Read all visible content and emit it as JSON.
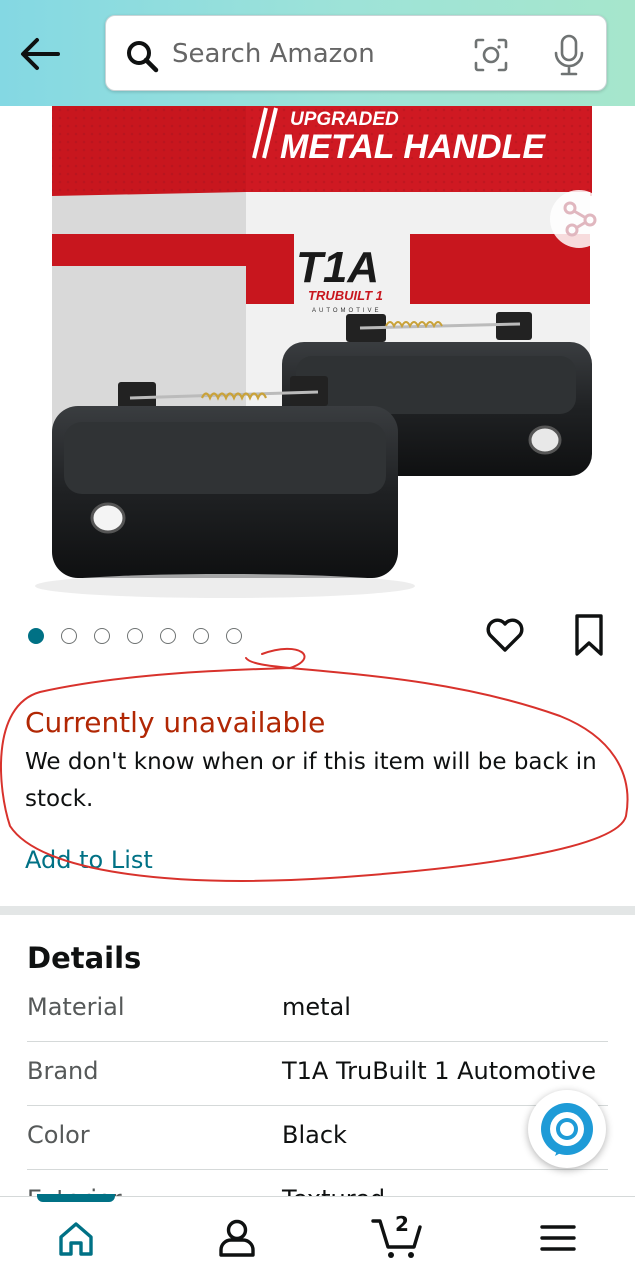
{
  "header": {
    "search": {
      "placeholder": "Search Amazon"
    }
  },
  "product_image": {
    "box_banner_top": "UPGRADED",
    "box_banner_main": "METAL HANDLE",
    "brand_logo": "T1A",
    "brand_sub": "TRUBUILT 1",
    "brand_tag": "AUTOMOTIVE"
  },
  "carousel": {
    "total": 7,
    "active_index": 0
  },
  "availability": {
    "title": "Currently unavailable",
    "message": "We don't know when or if this item will be back in stock.",
    "add_to_list": "Add to List"
  },
  "details": {
    "title": "Details",
    "rows": [
      {
        "label": "Material",
        "value": "metal"
      },
      {
        "label": "Brand",
        "value": "T1A TruBuilt 1 Automotive"
      },
      {
        "label": "Color",
        "value": "Black"
      },
      {
        "label": "Exterior",
        "value": "Textured"
      }
    ]
  },
  "bottom_nav": {
    "cart_count": "2",
    "active_tab": "home"
  },
  "colors": {
    "accent": "#007185",
    "unavailable": "#b12704",
    "annotation": "#d8322c"
  }
}
